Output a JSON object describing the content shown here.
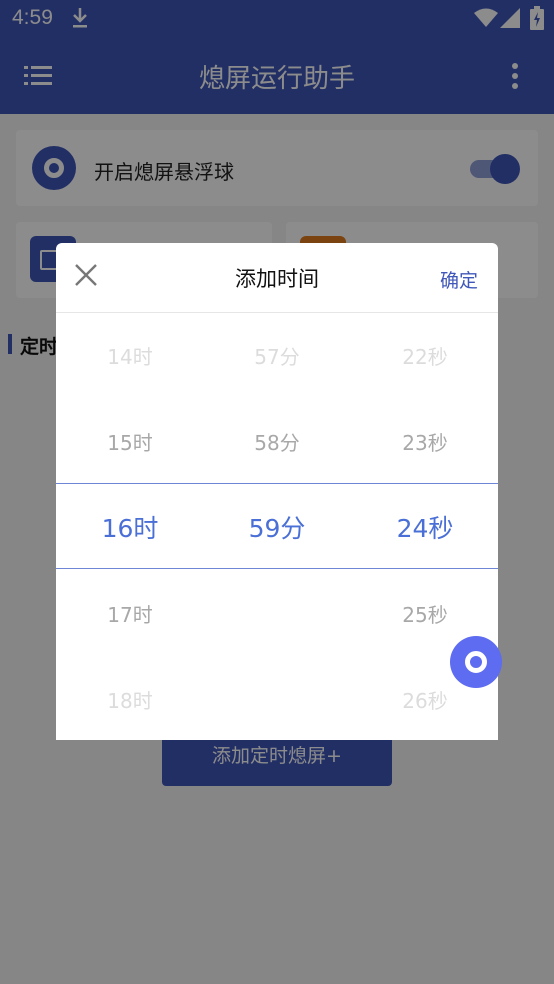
{
  "status_bar": {
    "time": "4:59"
  },
  "app_bar": {
    "title": "熄屏运行助手"
  },
  "float_card": {
    "label": "开启熄屏悬浮球",
    "enabled": true
  },
  "section": {
    "title": "定时"
  },
  "add_button": {
    "label": "添加定时熄屏+"
  },
  "dialog": {
    "title": "添加时间",
    "confirm_label": "确定",
    "hours": [
      "14时",
      "15时",
      "16时",
      "17时",
      "18时"
    ],
    "minutes": [
      "57分",
      "58分",
      "59分",
      "",
      ""
    ],
    "seconds": [
      "22秒",
      "23秒",
      "24秒",
      "25秒",
      "26秒"
    ],
    "selected": {
      "hour": "16时",
      "minute": "59分",
      "second": "24秒"
    }
  },
  "colors": {
    "primary": "#3f57b9",
    "accent": "#4a6fd6",
    "fab": "#5d6cf0"
  }
}
